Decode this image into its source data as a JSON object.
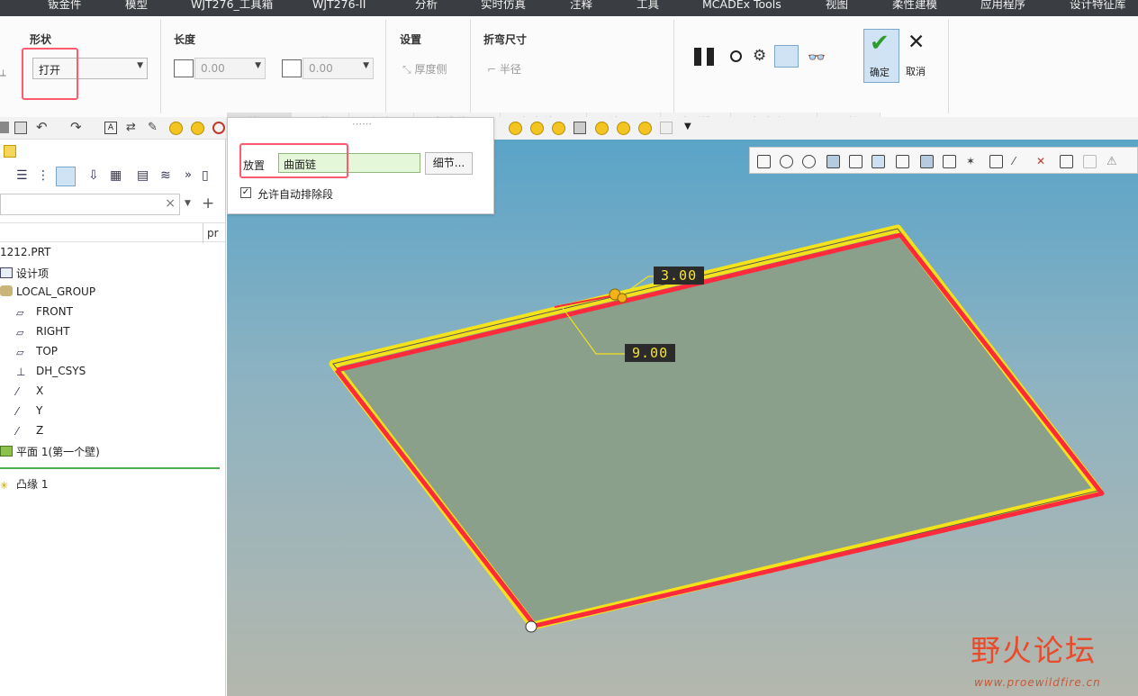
{
  "menu": {
    "tabs": [
      "钣金件",
      "模型",
      "WJT276_工具箱",
      "WJT276-II",
      "分析",
      "实时仿真",
      "注释",
      "工具",
      "MCADEx Tools",
      "视图",
      "柔性建模",
      "应用程序",
      "设计特征库"
    ]
  },
  "ribbon": {
    "shape_title": "形状",
    "shape_value": "打开",
    "length_title": "长度",
    "length_value1": "0.00",
    "length_value2": "0.00",
    "settings_title": "设置",
    "thickness_label": "厚度侧",
    "bend_dim_title": "折弯尺寸",
    "radius_label": "半径",
    "ok_label": "确定",
    "cancel_label": "取消",
    "subtabs": [
      "放置",
      "形状",
      "长度",
      "折弯位置",
      "拐角处理",
      "斜切口",
      "止裂槽",
      "折弯余量",
      "属性"
    ]
  },
  "popup": {
    "dots": "⋯⋯",
    "placement_label": "放置",
    "placement_value": "曲面链",
    "detail_button": "细节...",
    "auto_exclude_label": "允许自动排除段"
  },
  "tree": {
    "search_clear": "×",
    "column_label": "pr",
    "items": [
      {
        "label": "1212.PRT",
        "icon": "part-icon"
      },
      {
        "label": "设计项",
        "icon": "design-items-icon"
      },
      {
        "label": "LOCAL_GROUP",
        "icon": "group-icon"
      },
      {
        "label": "FRONT",
        "icon": "datum-plane-icon"
      },
      {
        "label": "RIGHT",
        "icon": "datum-plane-icon"
      },
      {
        "label": "TOP",
        "icon": "datum-plane-icon"
      },
      {
        "label": "DH_CSYS",
        "icon": "csys-icon"
      },
      {
        "label": "X",
        "icon": "datum-axis-icon"
      },
      {
        "label": "Y",
        "icon": "datum-axis-icon"
      },
      {
        "label": "Z",
        "icon": "datum-axis-icon"
      },
      {
        "label": "平面 1(第一个壁)",
        "icon": "planar-wall-icon"
      },
      {
        "label": "凸缘 1",
        "icon": "flange-icon"
      }
    ]
  },
  "viewport": {
    "dim1": "3.00",
    "dim2": "9.00"
  },
  "watermark": {
    "brand": "野火论坛",
    "url": "www.proewildfire.cn"
  },
  "colors": {
    "accent_red": "#ff2a3c",
    "edge_yellow": "#f4e21a",
    "plate_green": "#8aa08a",
    "ok_green": "#2e9b2e"
  }
}
